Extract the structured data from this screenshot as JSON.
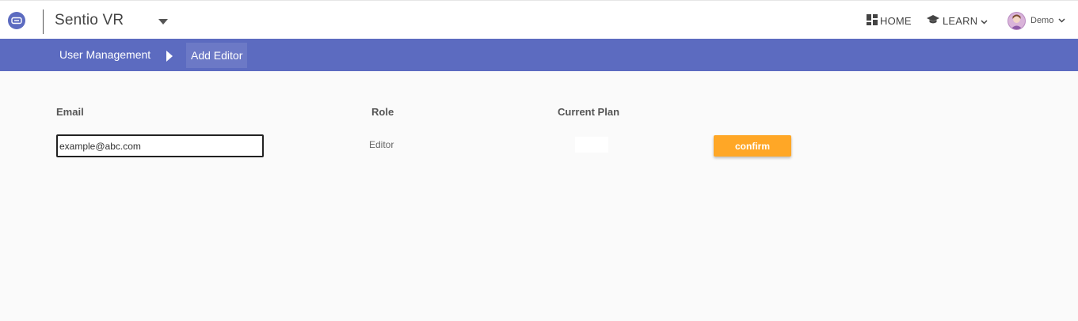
{
  "header": {
    "app_name": "Sentio VR",
    "nav": {
      "home_label": "HOME",
      "learn_label": "LEARN"
    },
    "user": {
      "name": "Demo"
    },
    "icons": {
      "logo": "vr-headset-icon",
      "app_dropdown": "caret-down-icon",
      "home": "grid-dashboard-icon",
      "learn": "graduation-cap-icon",
      "learn_dropdown": "chevron-down-icon",
      "user_dropdown": "chevron-down-icon"
    }
  },
  "breadcrumb": {
    "items": [
      "User Management",
      "Add Editor"
    ],
    "separator_icon": "caret-right-icon"
  },
  "form": {
    "columns": {
      "email": "Email",
      "role": "Role",
      "plan": "Current Plan"
    },
    "email_value": "example@abc.com",
    "role_value": "Editor",
    "plan_value": "",
    "confirm_label": "confirm"
  },
  "colors": {
    "accent": "#5c6bc0",
    "confirm": "#ffa726",
    "background": "#fafafa"
  }
}
